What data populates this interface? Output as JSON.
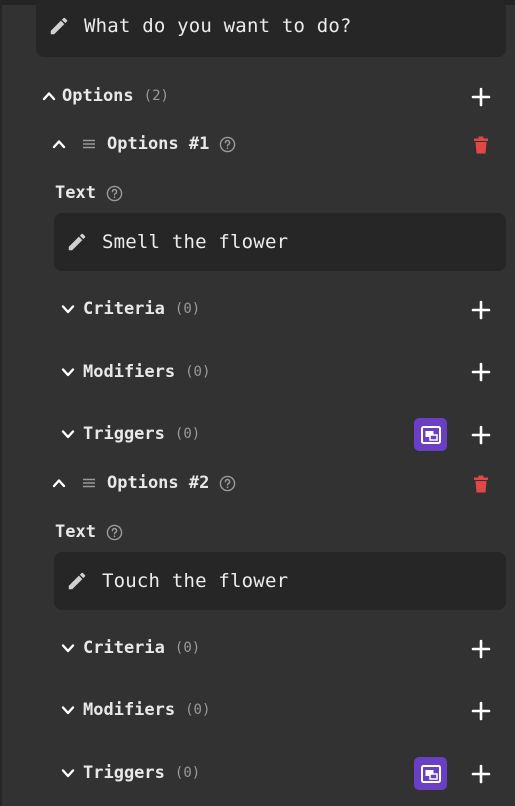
{
  "prompt": {
    "value": "What do you want to do?"
  },
  "options_header": {
    "label": "Options",
    "count": "(2)"
  },
  "options": [
    {
      "title": "Options #1",
      "text_label": "Text",
      "text_value": "Smell the flower",
      "criteria": {
        "label": "Criteria",
        "count": "(0)"
      },
      "modifiers": {
        "label": "Modifiers",
        "count": "(0)"
      },
      "triggers": {
        "label": "Triggers",
        "count": "(0)"
      }
    },
    {
      "title": "Options #2",
      "text_label": "Text",
      "text_value": "Touch the flower",
      "criteria": {
        "label": "Criteria",
        "count": "(0)"
      },
      "modifiers": {
        "label": "Modifiers",
        "count": "(0)"
      },
      "triggers": {
        "label": "Triggers",
        "count": "(0)"
      }
    }
  ],
  "icons": {
    "edit": "pencil-icon",
    "expand": "chevron-up-icon",
    "collapse": "chevron-down-icon",
    "add": "plus-icon",
    "delete": "trash-icon",
    "help": "help-icon",
    "drag": "drag-handle-icon",
    "trigger_action": "image-icon"
  },
  "colors": {
    "background": "#323232",
    "field": "#262626",
    "delete": "#e04848",
    "accent": "#6a3fc4"
  }
}
